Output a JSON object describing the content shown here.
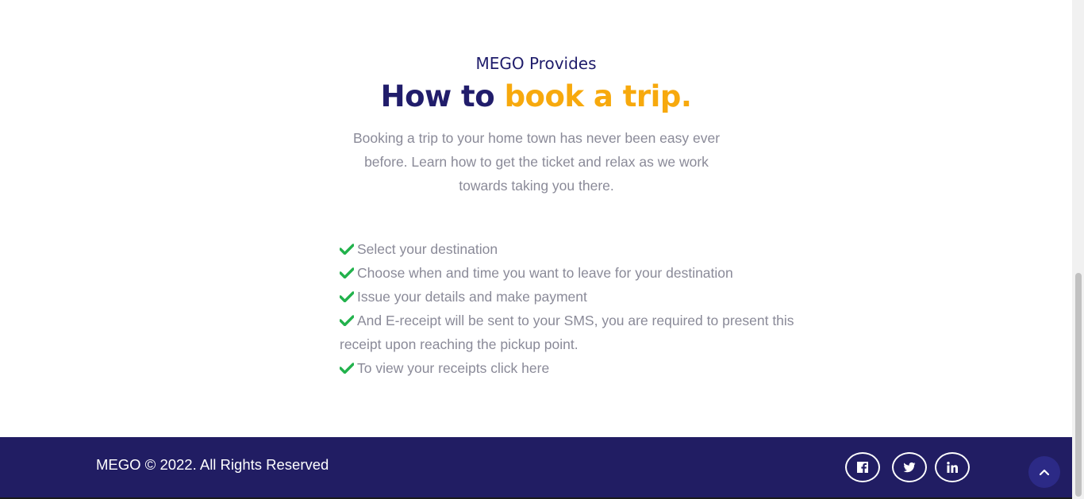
{
  "intro": {
    "eyebrow": "MEGO Provides",
    "heading_part1": "How to",
    "heading_part2": "book a trip.",
    "lead": "Booking a trip to your home town has never been easy ever before. Learn how to get the ticket and relax as we work towards taking you there."
  },
  "steps": [
    "Select your destination",
    "Choose when and time you want to leave for your destination",
    "Issue your details and make payment",
    "And E-receipt will be sent to your SMS, you are required to present this receipt upon reaching the pickup point.",
    "To view your receipts click here"
  ],
  "footer": {
    "copyright": "MEGO © 2022. All Rights Reserved",
    "social": [
      "facebook-icon",
      "twitter-icon",
      "linkedin-icon"
    ]
  },
  "colors": {
    "primary": "#211d6b",
    "accent": "#f7a90d",
    "check": "#22b24c",
    "footer_bg": "#211d63"
  }
}
